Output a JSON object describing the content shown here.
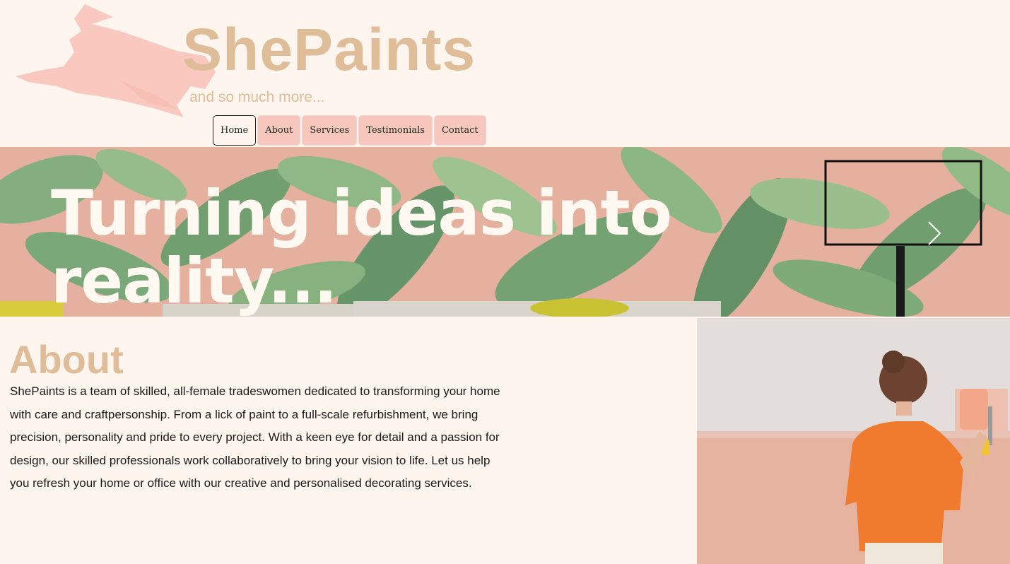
{
  "brand": {
    "title": "ShePaints",
    "tagline": "and so much more...",
    "colors": {
      "accent": "#dfbd98",
      "brush": "#f9c9c0",
      "nav_bg": "#f7c7be",
      "text": "#1a1a1a"
    }
  },
  "nav": {
    "items": [
      {
        "label": "Home",
        "active": true
      },
      {
        "label": "About"
      },
      {
        "label": "Services"
      },
      {
        "label": "Testimonials"
      },
      {
        "label": "Contact"
      }
    ]
  },
  "hero": {
    "line1": "Turning ideas into",
    "line2": "reality...",
    "next_icon": "chevron-right-icon"
  },
  "about": {
    "title": "About",
    "body": "ShePaints is a team of skilled, all-female tradeswomen dedicated to transforming your home with care and craftpersonship. From a lick of paint to  a full-scale refurbishment, we bring precision, personality and pride to  every project. With a keen eye for detail and a passion for design, our skilled professionals work collaboratively to bring your vision to life. Let us help you refresh your home or office with our creative and personalised decorating services."
  }
}
